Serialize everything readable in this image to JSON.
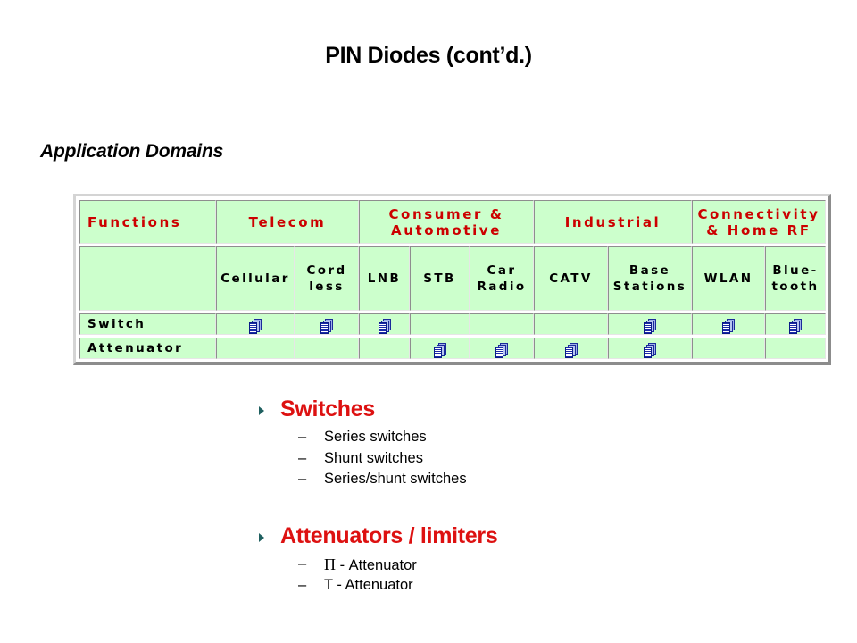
{
  "slide": {
    "title": "PIN Diodes (cont’d.)",
    "subtitle": "Application Domains"
  },
  "table": {
    "header_groups": {
      "functions": "Functions",
      "telecom": "Telecom",
      "consumer_line1": "Consumer &",
      "consumer_line2": "Automotive",
      "industrial": "Industrial",
      "connectivity_line1": "Connectivity",
      "connectivity_line2": "& Home RF"
    },
    "columns": {
      "cellular": "Cellular",
      "cordless_line1": "Cord",
      "cordless_line2": "less",
      "lnb": "LNB",
      "stb": "STB",
      "car_radio_line1": "Car",
      "car_radio_line2": "Radio",
      "catv": "CATV",
      "base_line1": "Base",
      "base_line2": "Stations",
      "wlan": "WLAN",
      "bluetooth_line1": "Blue-",
      "bluetooth_line2": "tooth"
    },
    "rows": [
      {
        "label": "Switch",
        "marks": {
          "cellular": true,
          "cordless": true,
          "lnb": true,
          "stb": false,
          "car_radio": false,
          "catv": false,
          "base_stations": true,
          "wlan": true,
          "bluetooth": true
        }
      },
      {
        "label": "Attenuator",
        "marks": {
          "cellular": false,
          "cordless": false,
          "lnb": false,
          "stb": true,
          "car_radio": true,
          "catv": true,
          "base_stations": true,
          "wlan": false,
          "bluetooth": false
        }
      }
    ],
    "mark_icon": "document-stack-icon",
    "colors": {
      "cell_bg": "#ccffcc",
      "header_text": "#cc0000"
    }
  },
  "bullets": [
    {
      "label": "Switches",
      "items": [
        "Series switches",
        "Shunt switches",
        "Series/shunt switches"
      ]
    },
    {
      "label": "Attenuators / limiters",
      "items": [
        {
          "symbol": "Π",
          "text": " - Attenuator"
        },
        {
          "symbol": "",
          "text": "T - Attenuator"
        }
      ]
    }
  ],
  "dash": "–",
  "colors": {
    "bullet_heading": "#dd1111",
    "bullet_arrow": "#1f6060"
  }
}
